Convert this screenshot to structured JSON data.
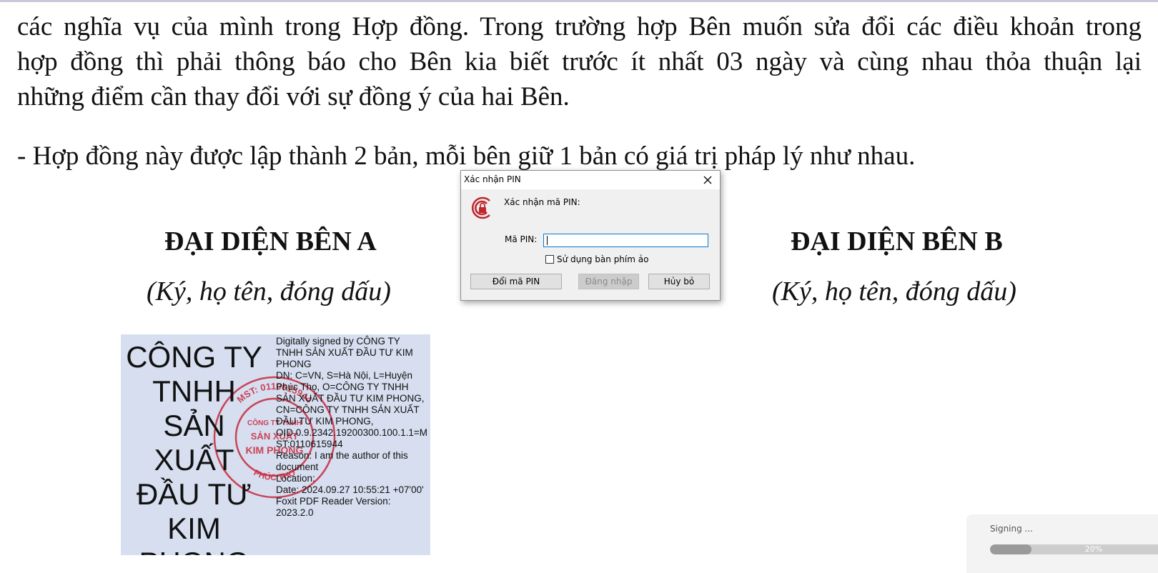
{
  "document": {
    "line1": "các nghĩa vụ của mình trong Hợp đồng. Trong trường hợp Bên muốn sửa đổi các điều khoản trong",
    "line2": "hợp đồng thì phải thông báo cho Bên kia biết trước ít nhất 03 ngày và cùng nhau thỏa thuận lại",
    "line3": "những điểm cần thay đổi với sự đồng ý của hai Bên.",
    "line4": "- Hợp đồng này được lập thành 2 bản, mỗi bên giữ 1 bản có giá trị pháp lý như nhau.",
    "party_a_title": "ĐẠI DIỆN BÊN A",
    "party_a_sub": "(Ký, họ tên, đóng dấu)",
    "party_b_title": "ĐẠI DIỆN BÊN B",
    "party_b_sub": "(Ký, họ tên, đóng dấu)"
  },
  "signature": {
    "name_lines": [
      "CÔNG TY",
      "TNHH",
      "SẢN XUẤT",
      "ĐẦU TƯ",
      "KIM",
      "PHONG"
    ],
    "info_lines": [
      "Digitally signed by CÔNG TY TNHH SẢN XUẤT ĐẦU TƯ KIM PHONG",
      "DN: C=VN, S=Hà Nội, L=Huyện Phúc Thọ, O=CÔNG TY TNHH SẢN XUẤT ĐẦU TƯ KIM PHONG, CN=CÔNG TY TNHH SẢN XUẤT ĐẦU TƯ KIM PHONG,",
      "OID.0.9.2342.19200300.100.1.1=MST:0110615944",
      "Reason: I am the author of this document",
      "Location:",
      "Date: 2024.09.27 10:55:21 +07'00'",
      "Foxit PDF Reader Version: 2023.2.0"
    ],
    "stamp": {
      "color": "#c8283c",
      "ring_text": "MST: 0110615944",
      "center_top": "CÔNG TY TNHH",
      "center_mid": "SẢN XUẤT",
      "center_bottom": "KIM PHONG",
      "bottom_text": "PHÚC THỌ"
    }
  },
  "dialog": {
    "title": "Xác nhận PIN",
    "prompt": "Xác nhận mã PIN:",
    "pin_label": "Mã PIN:",
    "pin_value": "",
    "checkbox_label": "Sử dụng bàn phím ảo",
    "checkbox_checked": false,
    "btn_change_pin": "Đổi mã PIN",
    "btn_login": "Đăng nhập",
    "btn_cancel": "Hủy bỏ",
    "logo_color": "#c0272d",
    "icons": {
      "close": "close-icon",
      "logo": "app-logo-icon"
    }
  },
  "toast": {
    "text": "Signing ...",
    "progress_percent": 20,
    "progress_label": "20%"
  }
}
